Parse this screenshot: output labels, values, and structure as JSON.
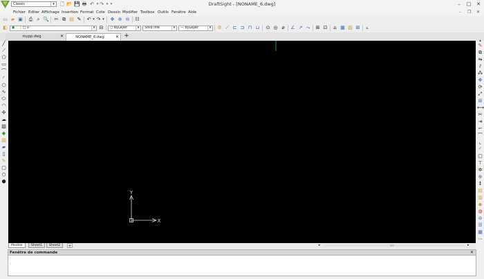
{
  "app": {
    "window_title": "DraftSight - [NONAME_6.dwg]",
    "workspace": "Classic"
  },
  "menu": [
    "Fichier",
    "Editer",
    "Affichage",
    "Insertion",
    "Format",
    "Cote",
    "Dessin",
    "Modifier",
    "Toolbox",
    "Outils",
    "Fenêtre",
    "Aide"
  ],
  "layer_bar": {
    "layer_value": "0",
    "color_value": "ByLayer",
    "linestyle_value": "Solid line",
    "lineweight_value": "ByLayer"
  },
  "doc_tabs": [
    {
      "label": "mypp.dwg",
      "close": "✕"
    },
    {
      "label": "NONAME_6.dwg",
      "close": "✕"
    }
  ],
  "new_tab_symbol": "+",
  "ucs": {
    "x_label": "X",
    "y_label": "Y"
  },
  "layout_tabs": [
    "Modèle",
    "Sheet1",
    "Sheet2"
  ],
  "add_layout_symbol": "+",
  "command_window": {
    "title": "Fenêtre de commande",
    "close": "✕",
    "prompt": ":"
  },
  "window_controls": {
    "minimize": "–",
    "maximize": "□",
    "close": "✕"
  },
  "mdi_controls": {
    "minimize": "–",
    "restore": "❐",
    "close": "✕"
  },
  "colors": {
    "canvas": "#000000",
    "cursor": "#1e9a3a",
    "chrome": "#f0f0f0"
  }
}
